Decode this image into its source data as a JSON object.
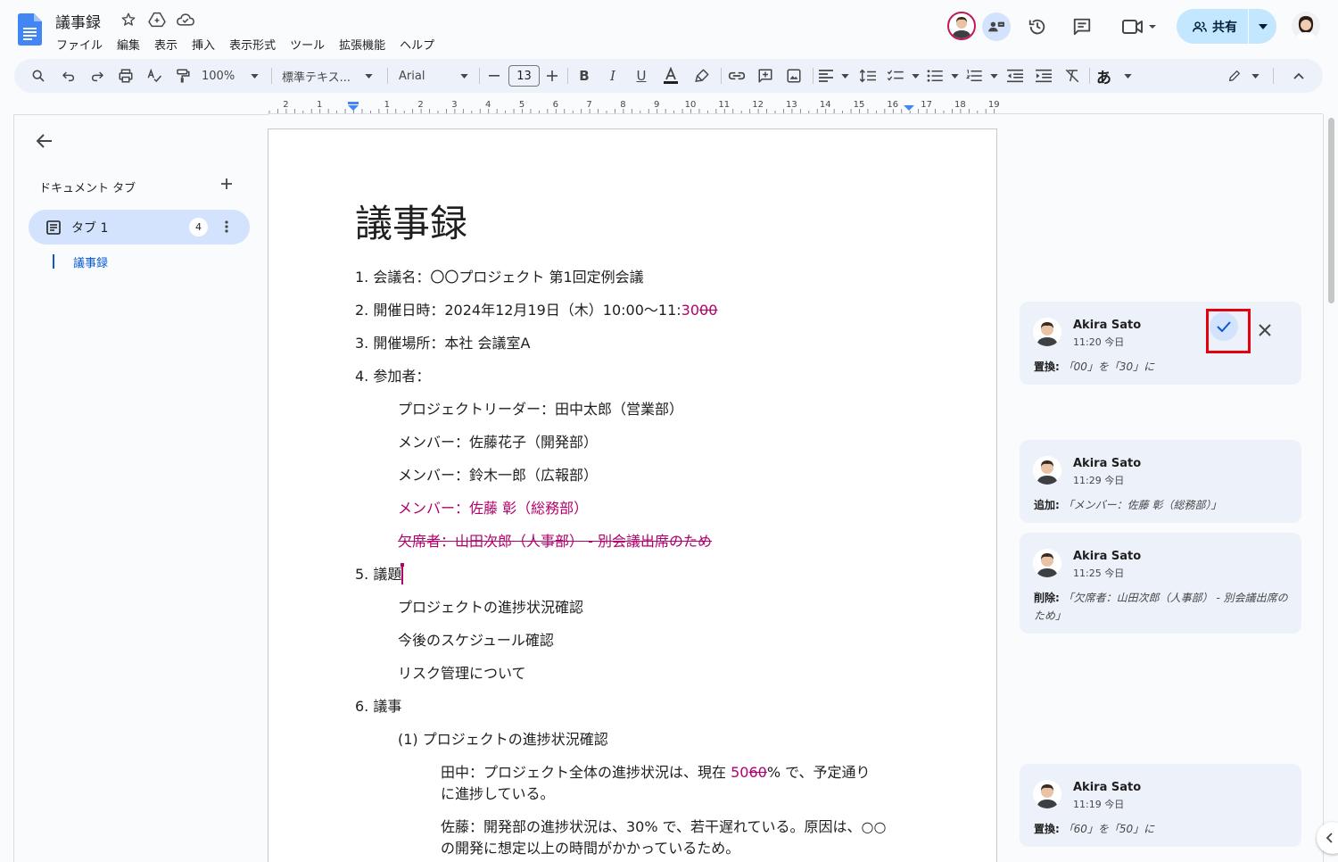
{
  "app": {
    "doc_title": "議事録",
    "menu": [
      "ファイル",
      "編集",
      "表示",
      "挿入",
      "表示形式",
      "ツール",
      "拡張機能",
      "ヘルプ"
    ],
    "share_label": "共有"
  },
  "toolbar": {
    "zoom": "100%",
    "style": "標準テキス...",
    "font": "Arial",
    "font_size": "13",
    "input_mode": "あ"
  },
  "ruler": {
    "ticks": [
      "2",
      "1",
      "1",
      "2",
      "3",
      "4",
      "5",
      "6",
      "7",
      "8",
      "9",
      "10",
      "11",
      "12",
      "13",
      "14",
      "15",
      "16",
      "17",
      "18",
      "19"
    ]
  },
  "sidebar": {
    "header": "ドキュメント タブ",
    "tab_label": "タブ 1",
    "tab_badge": "4",
    "outline_item": "議事録"
  },
  "document": {
    "heading": "議事録",
    "l1": "1. 会議名：〇〇プロジェクト 第1回定例会議",
    "l2_prefix": "2. 開催日時：2024年12月19日（木）10:00〜11:",
    "l2_ins": "30",
    "l2_del": "00",
    "l3": "3. 開催場所：本社 会議室A",
    "l4": "4. 参加者：",
    "l4a": "プロジェクトリーダー：田中太郎（営業部）",
    "l4b": "メンバー：佐藤花子（開発部）",
    "l4c": "メンバー：鈴木一郎（広報部）",
    "l4d_ins": "メンバー：佐藤 彰（総務部）",
    "l4e_del": "欠席者：山田次郎（人事部） - 別会議出席のため",
    "l5": "5. 議題",
    "l5a": "プロジェクトの進捗状況確認",
    "l5b": "今後のスケジュール確認",
    "l5c": "リスク管理について",
    "l6": "6. 議事",
    "l6a": "(1) プロジェクトの進捗状況確認",
    "p1_prefix": "田中：プロジェクト全体の進捗状況は、現在 ",
    "p1_ins": "50",
    "p1_del": "60",
    "p1_suffix": "% で、予定通り",
    "p1_line2": "に進捗している。",
    "p2_line1": "佐藤：開発部の進捗状況は、30% で、若干遅れている。原因は、○○",
    "p2_line2": "の開発に想定以上の時間がかかっているため。"
  },
  "suggestions": [
    {
      "author": "Akira Sato",
      "time": "11:20 今日",
      "type": "置換:",
      "text": "「00」を「30」に"
    },
    {
      "author": "Akira Sato",
      "time": "11:29 今日",
      "type": "追加:",
      "text": "「メンバー：佐藤 彰（総務部）」"
    },
    {
      "author": "Akira Sato",
      "time": "11:25 今日",
      "type": "削除:",
      "text": "「欠席者：山田次郎（人事部） - 別会議出席のため」"
    },
    {
      "author": "Akira Sato",
      "time": "11:19 今日",
      "type": "置換:",
      "text": "「60」を「50」に"
    }
  ],
  "colors": {
    "suggestion": "#b3006b",
    "accent": "#0b57d0",
    "share_bg": "#c2e7ff",
    "highlight": "#e3000f"
  }
}
